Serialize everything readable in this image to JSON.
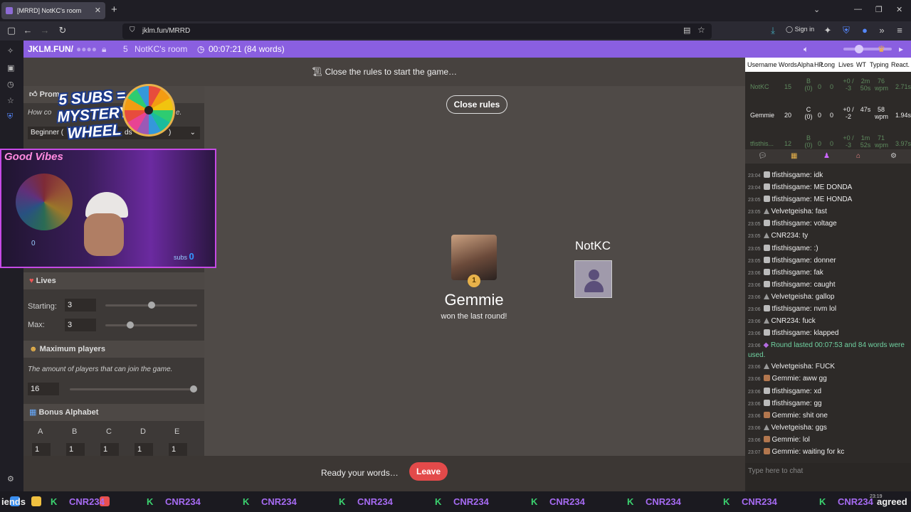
{
  "browser": {
    "tab_title": "[MRRD] NotKC's room",
    "url": "jklm.fun/MRRD",
    "sign_in": "Sign in"
  },
  "room": {
    "site": "JKLM.FUN/",
    "player_count": "5",
    "room_name": "NotKC's room",
    "timer": "00:07:21 (84 words)"
  },
  "game": {
    "notice": "Close the rules to start the game…",
    "close_rules": "Close rules",
    "ready_text": "Ready your words…",
    "leave": "Leave",
    "winner_name": "Gemmie",
    "winner_rank": "1",
    "winner_sub": "won the last round!",
    "player2_name": "NotKC"
  },
  "settings": {
    "prompt_header": "Prom",
    "prompt_desc": "How co",
    "prompt_desc_end": "e.",
    "difficulty": "Beginner (",
    "difficulty_mid": "ds",
    "difficulty_end": ")",
    "lives_header": "Lives",
    "starting_label": "Starting:",
    "starting_value": "3",
    "starting_fraction": 0.5,
    "max_label": "Max:",
    "max_value": "3",
    "max_fraction": 0.25,
    "max_players_header": "Maximum players",
    "max_players_desc": "The amount of players that can join the game.",
    "max_players_value": "16",
    "max_players_fraction": 1.0,
    "bonus_header": "Bonus Alphabet",
    "bonus_letters": [
      {
        "letter": "A",
        "value": "1"
      },
      {
        "letter": "B",
        "value": "1"
      },
      {
        "letter": "C",
        "value": "1"
      },
      {
        "letter": "D",
        "value": "1"
      },
      {
        "letter": "E",
        "value": "1"
      }
    ]
  },
  "overlay": {
    "mystery_line1": "5 SUBS =",
    "mystery_line2": "MYSTERY",
    "mystery_line3": "WHEEL",
    "good_vibes": "Good Vibes",
    "subs_label": "subs",
    "subs_count": "0",
    "cam_wheel_value": "0"
  },
  "scoreboard": {
    "headers": [
      "Username",
      "Words",
      "Alpha",
      "HP",
      "Long",
      "Lives",
      "WT",
      "Typing",
      "React."
    ],
    "rows": [
      {
        "username": "NotKC",
        "words": "15",
        "alpha": "B (0)",
        "hp": "0",
        "long": "0",
        "lives": "+0 / -3",
        "wt": "2m 50s",
        "typing": "76 wpm",
        "react": "2.71s"
      },
      {
        "username": "Gemmie",
        "words": "20",
        "alpha": "C (0)",
        "hp": "0",
        "long": "0",
        "lives": "+0 / -2",
        "wt": "47s",
        "typing": "58 wpm",
        "react": "1.94s"
      },
      {
        "username": "tfisthis...",
        "words": "12",
        "alpha": "B (0)",
        "hp": "0",
        "long": "0",
        "lives": "+0 / -3",
        "wt": "1m 52s",
        "typing": "71 wpm",
        "react": "3.97s"
      }
    ]
  },
  "chat": {
    "messages": [
      {
        "time": "23:04",
        "icon": "twitch",
        "user": "tfisthisgame",
        "text": "idk"
      },
      {
        "time": "23:04",
        "icon": "twitch",
        "user": "tfisthisgame",
        "text": "ME DONDA"
      },
      {
        "time": "23:05",
        "icon": "twitch",
        "user": "tfisthisgame",
        "text": "ME HONDA"
      },
      {
        "time": "23:05",
        "icon": "guest",
        "user": "Velvetgeisha",
        "text": "fast"
      },
      {
        "time": "23:05",
        "icon": "twitch",
        "user": "tfisthisgame",
        "text": "voltage"
      },
      {
        "time": "23:05",
        "icon": "guest",
        "user": "CNR234",
        "text": "ty"
      },
      {
        "time": "23:05",
        "icon": "twitch",
        "user": "tfisthisgame",
        "text": ":)"
      },
      {
        "time": "23:05",
        "icon": "twitch",
        "user": "tfisthisgame",
        "text": "donner"
      },
      {
        "time": "23:06",
        "icon": "twitch",
        "user": "tfisthisgame",
        "text": "fak"
      },
      {
        "time": "23:06",
        "icon": "twitch",
        "user": "tfisthisgame",
        "text": "caught"
      },
      {
        "time": "23:06",
        "icon": "guest",
        "user": "Velvetgeisha",
        "text": "gallop"
      },
      {
        "time": "23:06",
        "icon": "twitch",
        "user": "tfisthisgame",
        "text": "nvm lol"
      },
      {
        "time": "23:06",
        "icon": "guest",
        "user": "CNR234",
        "text": "fuck"
      },
      {
        "time": "23:06",
        "icon": "twitch",
        "user": "tfisthisgame",
        "text": "klapped"
      },
      {
        "time": "23:06",
        "icon": "system",
        "user": "",
        "text": "Round lasted 00:07:53 and 84 words were used."
      },
      {
        "time": "23:06",
        "icon": "guest",
        "user": "Velvetgeisha",
        "text": "FUCK"
      },
      {
        "time": "23:06",
        "icon": "avatar",
        "user": "Gemmie",
        "text": "aww gg"
      },
      {
        "time": "23:06",
        "icon": "twitch",
        "user": "tfisthisgame",
        "text": "xd"
      },
      {
        "time": "23:06",
        "icon": "twitch",
        "user": "tfisthisgame",
        "text": "gg"
      },
      {
        "time": "23:06",
        "icon": "avatar",
        "user": "Gemmie",
        "text": "shit one"
      },
      {
        "time": "23:06",
        "icon": "guest",
        "user": "Velvetgeisha",
        "text": "ggs"
      },
      {
        "time": "23:06",
        "icon": "avatar",
        "user": "Gemmie",
        "text": "lol"
      },
      {
        "time": "23:07",
        "icon": "avatar",
        "user": "Gemmie",
        "text": "waiting for kc"
      }
    ],
    "input_placeholder": "Type here to chat"
  },
  "taskbar": {
    "ticker": [
      "iends",
      "CNR234",
      "CNR234",
      "CNR234",
      "CNR234",
      "CNR234",
      "CNR234",
      "CNR234",
      "CNR234",
      "CNR234",
      "agreed"
    ],
    "clock_time": "23:19"
  }
}
